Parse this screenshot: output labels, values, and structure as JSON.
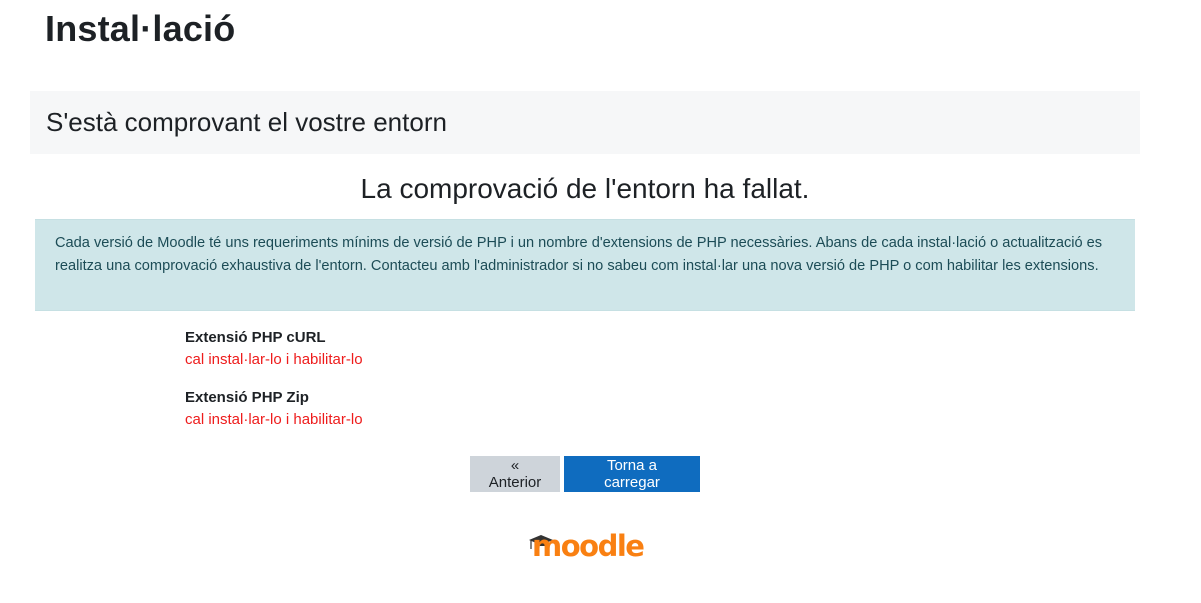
{
  "page": {
    "title": "Instal·lació"
  },
  "stage": {
    "title": "S'està comprovant el vostre entorn"
  },
  "result": {
    "heading": "La comprovació de l'entorn ha fallat."
  },
  "info": {
    "text": "Cada versió de Moodle té uns requeriments mínims de versió de PHP i un nombre d'extensions de PHP necessàries. Abans de cada instal·lació o actualització es realitza una comprovació exhaustiva de l'entorn. Contacteu amb l'administrador si no sabeu com instal·lar una nova versió de PHP o com habilitar les extensions."
  },
  "requirements": [
    {
      "name": "Extensió PHP cURL",
      "status": "cal instal·lar-lo i habilitar-lo"
    },
    {
      "name": "Extensió PHP Zip",
      "status": "cal instal·lar-lo i habilitar-lo"
    }
  ],
  "buttons": {
    "previous_label": "« Anterior",
    "reload_label": "Torna a carregar"
  },
  "logo": {
    "text": "moodle",
    "icon": "moodle-logo-icon",
    "color": "#f98012"
  },
  "colors": {
    "error": "#ee1c1c",
    "primary": "#0f6cbf",
    "info_bg": "#cfe6e9"
  }
}
